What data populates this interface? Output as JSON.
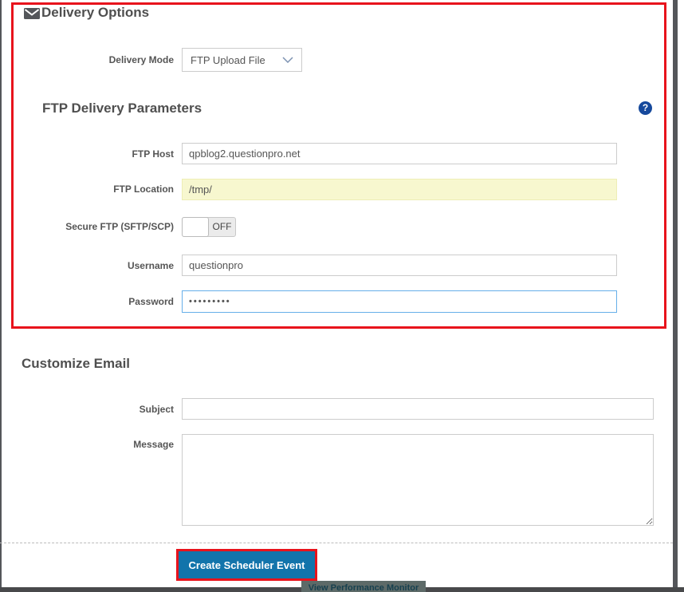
{
  "colors": {
    "annotation_red": "#e8131c",
    "button_blue": "#1274ab",
    "help_icon_blue": "#16499c",
    "location_highlight_yellow": "#f7f7cf",
    "password_focus_border": "#66afe9",
    "frame_gray": "#54565a"
  },
  "icons": {
    "header_icon": "envelope-icon",
    "dropdown_icon": "chevron-down-icon",
    "help_icon": "question-icon"
  },
  "delivery_options": {
    "title": "Delivery Options",
    "delivery_mode": {
      "label": "Delivery Mode",
      "selected_value": "FTP Upload File"
    }
  },
  "ftp_parameters": {
    "title": "FTP Delivery Parameters",
    "help_glyph": "?",
    "ftp_host": {
      "label": "FTP Host",
      "value": "qpblog2.questionpro.net"
    },
    "ftp_location": {
      "label": "FTP Location",
      "value": "/tmp/"
    },
    "secure_ftp": {
      "label": "Secure FTP (SFTP/SCP)",
      "state": "OFF"
    },
    "username": {
      "label": "Username",
      "value": "questionpro"
    },
    "password": {
      "label": "Password",
      "value": "•••••••••"
    }
  },
  "customize_email": {
    "title": "Customize Email",
    "subject": {
      "label": "Subject",
      "value": ""
    },
    "message": {
      "label": "Message",
      "value": ""
    }
  },
  "footer": {
    "create_button_label": "Create Scheduler Event",
    "status_popup_text": "View Performance Monitor"
  }
}
